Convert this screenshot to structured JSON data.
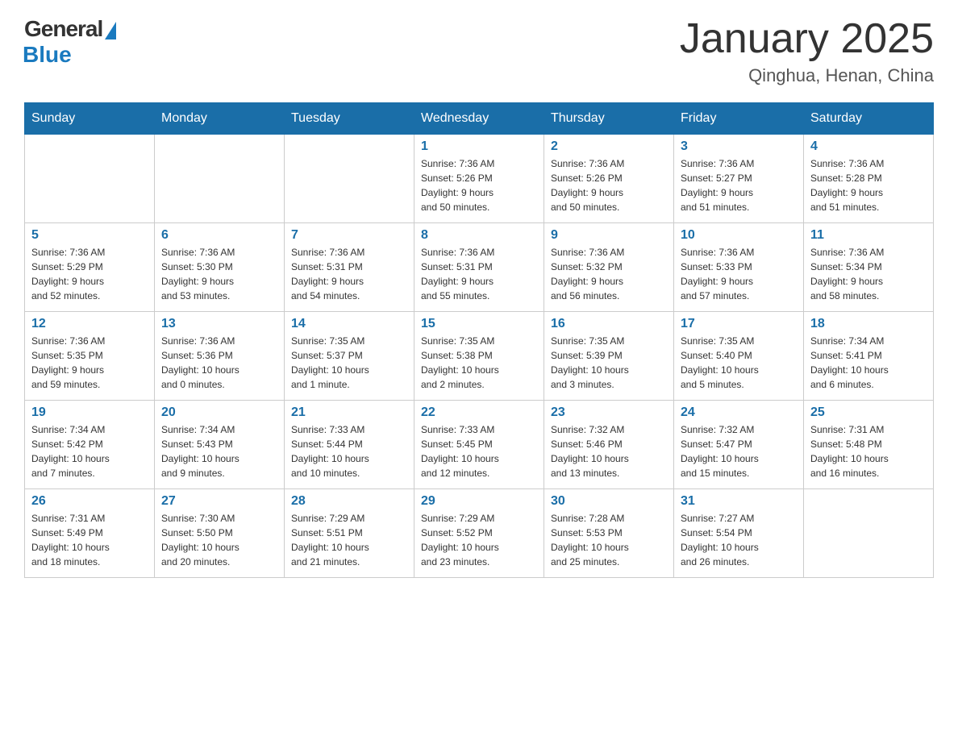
{
  "logo": {
    "general": "General",
    "blue": "Blue"
  },
  "header": {
    "month": "January 2025",
    "location": "Qinghua, Henan, China"
  },
  "days_of_week": [
    "Sunday",
    "Monday",
    "Tuesday",
    "Wednesday",
    "Thursday",
    "Friday",
    "Saturday"
  ],
  "weeks": [
    [
      {
        "day": "",
        "info": ""
      },
      {
        "day": "",
        "info": ""
      },
      {
        "day": "",
        "info": ""
      },
      {
        "day": "1",
        "info": "Sunrise: 7:36 AM\nSunset: 5:26 PM\nDaylight: 9 hours\nand 50 minutes."
      },
      {
        "day": "2",
        "info": "Sunrise: 7:36 AM\nSunset: 5:26 PM\nDaylight: 9 hours\nand 50 minutes."
      },
      {
        "day": "3",
        "info": "Sunrise: 7:36 AM\nSunset: 5:27 PM\nDaylight: 9 hours\nand 51 minutes."
      },
      {
        "day": "4",
        "info": "Sunrise: 7:36 AM\nSunset: 5:28 PM\nDaylight: 9 hours\nand 51 minutes."
      }
    ],
    [
      {
        "day": "5",
        "info": "Sunrise: 7:36 AM\nSunset: 5:29 PM\nDaylight: 9 hours\nand 52 minutes."
      },
      {
        "day": "6",
        "info": "Sunrise: 7:36 AM\nSunset: 5:30 PM\nDaylight: 9 hours\nand 53 minutes."
      },
      {
        "day": "7",
        "info": "Sunrise: 7:36 AM\nSunset: 5:31 PM\nDaylight: 9 hours\nand 54 minutes."
      },
      {
        "day": "8",
        "info": "Sunrise: 7:36 AM\nSunset: 5:31 PM\nDaylight: 9 hours\nand 55 minutes."
      },
      {
        "day": "9",
        "info": "Sunrise: 7:36 AM\nSunset: 5:32 PM\nDaylight: 9 hours\nand 56 minutes."
      },
      {
        "day": "10",
        "info": "Sunrise: 7:36 AM\nSunset: 5:33 PM\nDaylight: 9 hours\nand 57 minutes."
      },
      {
        "day": "11",
        "info": "Sunrise: 7:36 AM\nSunset: 5:34 PM\nDaylight: 9 hours\nand 58 minutes."
      }
    ],
    [
      {
        "day": "12",
        "info": "Sunrise: 7:36 AM\nSunset: 5:35 PM\nDaylight: 9 hours\nand 59 minutes."
      },
      {
        "day": "13",
        "info": "Sunrise: 7:36 AM\nSunset: 5:36 PM\nDaylight: 10 hours\nand 0 minutes."
      },
      {
        "day": "14",
        "info": "Sunrise: 7:35 AM\nSunset: 5:37 PM\nDaylight: 10 hours\nand 1 minute."
      },
      {
        "day": "15",
        "info": "Sunrise: 7:35 AM\nSunset: 5:38 PM\nDaylight: 10 hours\nand 2 minutes."
      },
      {
        "day": "16",
        "info": "Sunrise: 7:35 AM\nSunset: 5:39 PM\nDaylight: 10 hours\nand 3 minutes."
      },
      {
        "day": "17",
        "info": "Sunrise: 7:35 AM\nSunset: 5:40 PM\nDaylight: 10 hours\nand 5 minutes."
      },
      {
        "day": "18",
        "info": "Sunrise: 7:34 AM\nSunset: 5:41 PM\nDaylight: 10 hours\nand 6 minutes."
      }
    ],
    [
      {
        "day": "19",
        "info": "Sunrise: 7:34 AM\nSunset: 5:42 PM\nDaylight: 10 hours\nand 7 minutes."
      },
      {
        "day": "20",
        "info": "Sunrise: 7:34 AM\nSunset: 5:43 PM\nDaylight: 10 hours\nand 9 minutes."
      },
      {
        "day": "21",
        "info": "Sunrise: 7:33 AM\nSunset: 5:44 PM\nDaylight: 10 hours\nand 10 minutes."
      },
      {
        "day": "22",
        "info": "Sunrise: 7:33 AM\nSunset: 5:45 PM\nDaylight: 10 hours\nand 12 minutes."
      },
      {
        "day": "23",
        "info": "Sunrise: 7:32 AM\nSunset: 5:46 PM\nDaylight: 10 hours\nand 13 minutes."
      },
      {
        "day": "24",
        "info": "Sunrise: 7:32 AM\nSunset: 5:47 PM\nDaylight: 10 hours\nand 15 minutes."
      },
      {
        "day": "25",
        "info": "Sunrise: 7:31 AM\nSunset: 5:48 PM\nDaylight: 10 hours\nand 16 minutes."
      }
    ],
    [
      {
        "day": "26",
        "info": "Sunrise: 7:31 AM\nSunset: 5:49 PM\nDaylight: 10 hours\nand 18 minutes."
      },
      {
        "day": "27",
        "info": "Sunrise: 7:30 AM\nSunset: 5:50 PM\nDaylight: 10 hours\nand 20 minutes."
      },
      {
        "day": "28",
        "info": "Sunrise: 7:29 AM\nSunset: 5:51 PM\nDaylight: 10 hours\nand 21 minutes."
      },
      {
        "day": "29",
        "info": "Sunrise: 7:29 AM\nSunset: 5:52 PM\nDaylight: 10 hours\nand 23 minutes."
      },
      {
        "day": "30",
        "info": "Sunrise: 7:28 AM\nSunset: 5:53 PM\nDaylight: 10 hours\nand 25 minutes."
      },
      {
        "day": "31",
        "info": "Sunrise: 7:27 AM\nSunset: 5:54 PM\nDaylight: 10 hours\nand 26 minutes."
      },
      {
        "day": "",
        "info": ""
      }
    ]
  ]
}
